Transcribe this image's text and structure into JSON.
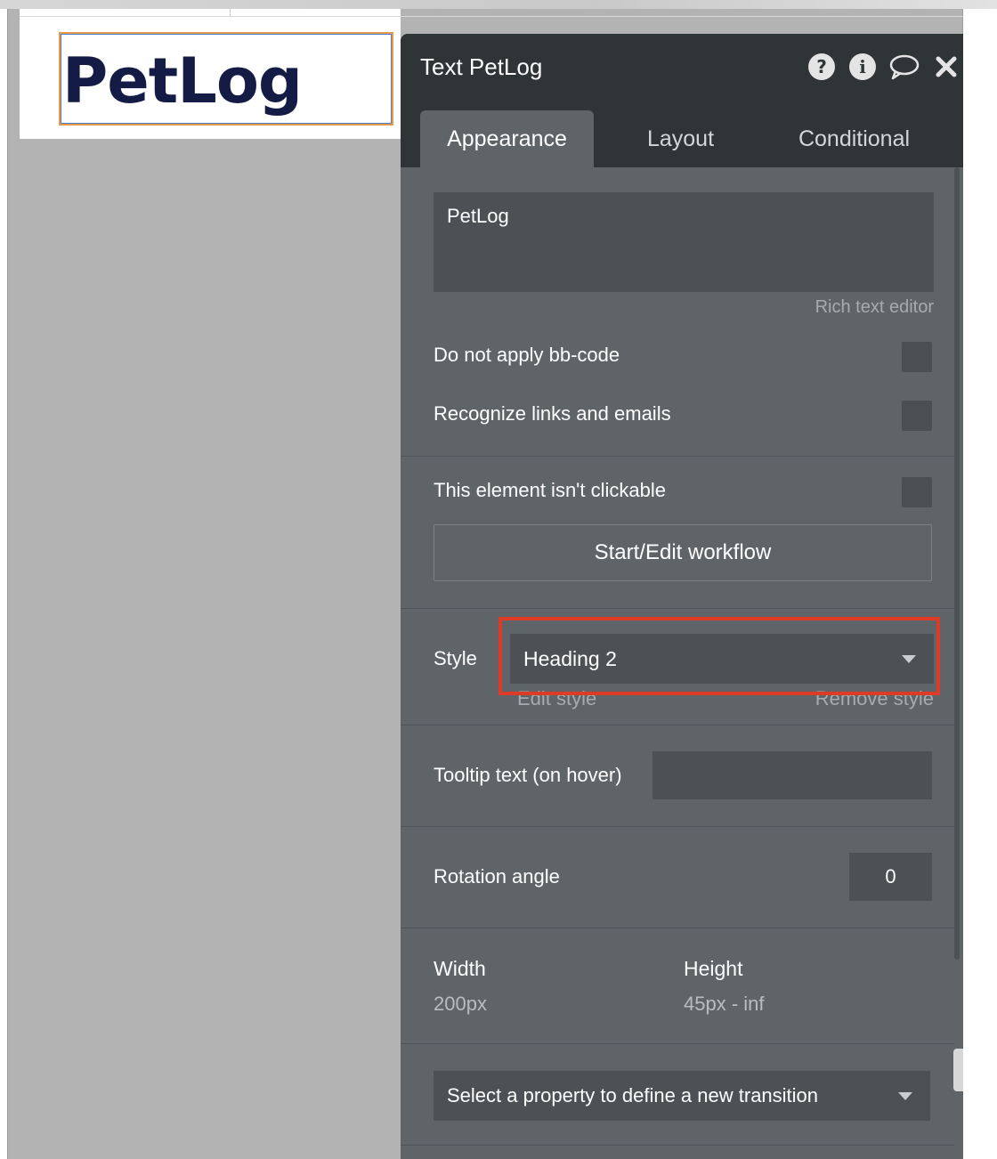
{
  "canvas": {
    "element_text": "PetLog"
  },
  "panel": {
    "title": "Text PetLog",
    "header_icons": [
      "help-icon",
      "info-icon",
      "comment-icon",
      "close-icon"
    ],
    "tabs": [
      {
        "label": "Appearance",
        "active": true
      },
      {
        "label": "Layout",
        "active": false
      },
      {
        "label": "Conditional",
        "active": false
      }
    ],
    "text_content": "PetLog",
    "rich_text_link": "Rich text editor",
    "options": {
      "bb_code": "Do not apply bb-code",
      "links": "Recognize links and emails",
      "not_clickable": "This element isn't clickable"
    },
    "workflow_button": "Start/Edit workflow",
    "style": {
      "label": "Style",
      "value": "Heading 2",
      "edit_link": "Edit style",
      "remove_link": "Remove style",
      "highlight_color": "#de3a26"
    },
    "tooltip": {
      "label": "Tooltip text (on hover)",
      "value": ""
    },
    "rotation": {
      "label": "Rotation angle",
      "value": "0"
    },
    "dimensions": {
      "width_label": "Width",
      "width_value": "200px",
      "height_label": "Height",
      "height_value": "45px - inf"
    },
    "transition_placeholder": "Select a property to define a new transition"
  },
  "colors": {
    "panel_bg": "#5f6469",
    "header_bg": "#2f3437",
    "heading_text": "#141c45",
    "canvas_bg": "#b3b3b3"
  }
}
